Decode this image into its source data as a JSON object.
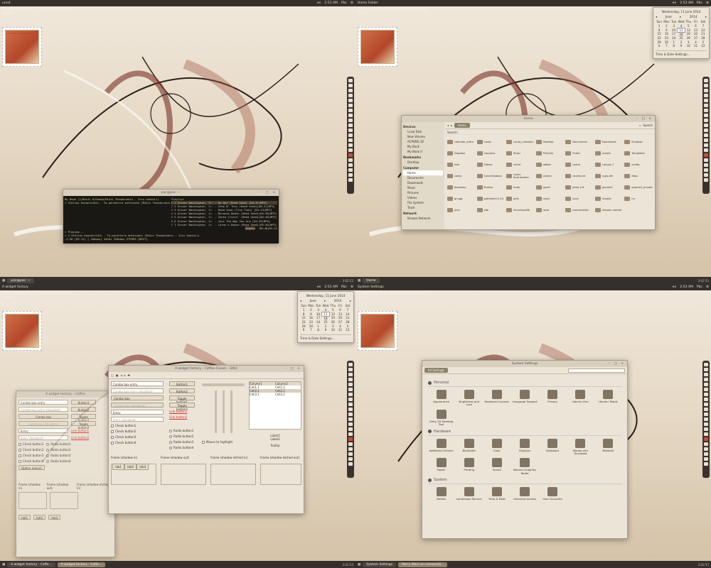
{
  "q1": {
    "topbar": {
      "title": "urxvt",
      "lang": "en",
      "time": "2:53 AM",
      "user": "Pbc"
    },
    "note": [
      "Stelios Kazantzidis - Ta parathira anthisane",
      "mocp *"
    ],
    "stamp_text": "ΕΛΛΗΝΙΚΗ ΔΗΜΟΚΡΑΤΙΑ",
    "terminal": {
      "title": "pac@pac: ~",
      "left_head": "My Book (1/Music H/Goodo/Mikis Theodorakis - Itin anatoli)",
      "right_head": "Playlist",
      "left_line": "2 Stelios Kazantzidis - Ta parathira anthisane (Mikis Theodorakis - Itin Anatoli) [04:03]",
      "playlist": [
        "1 1 Grover Washington, Jr. - Do Dat (Reed Seed) [04:31|MP3]",
        "2 2 Grover Washington, Jr. - Step N' Thru (Reed Seed)[06:31|MP3]",
        "3 3 Grover Washington, Jr. - Reed Seed (Trio Tune) [04:13|MP3]",
        "4 4 Grover Washington, Jr. - Maracas Beach (Reed Seed)[04:58|MP3]",
        "5 5 Grover Washington, Jr. - Santa Cruzin' (Reed Seed)[05:46|MP3]",
        "6 6 Grover Washington, Jr. - Just The Way You Are [04:59|MP3]",
        "7 7 Grover Washington, Jr. - Loran's Dance (Reed Seed)[05:40|MP3]"
      ],
      "status_label": "Repeat",
      "time": "00:48|03:12",
      "playing": "> Playing...",
      "now": "> 2 Stelios Kazantzidis - Ta parathira anthisane (Mikis Theodorakis - Itin Anatoli)",
      "info": "-2:56 [03:12] [ 44kbps] 44kHz 320kbps STEREO [NEXT]"
    },
    "task": "pac@pac: ~",
    "clock": "3:02:53"
  },
  "q2": {
    "topbar": {
      "title": "Home Folder",
      "lang": "en",
      "time": "2:53 AM",
      "user": "Pbc"
    },
    "note": [
      "Stelios Kazantzidis - Ta parathira anthisane",
      "mocp *"
    ],
    "calendar": {
      "header": "Wednesday, 11 June 2014",
      "month": "June",
      "year": "2014",
      "days": [
        "Sun",
        "Mon",
        "Tue",
        "Wed",
        "Thu",
        "Fri",
        "Sat"
      ],
      "weeks": [
        [
          "1",
          "2",
          "3",
          "4",
          "5",
          "6",
          "7"
        ],
        [
          "8",
          "9",
          "10",
          "11",
          "12",
          "13",
          "14"
        ],
        [
          "15",
          "16",
          "17",
          "18",
          "19",
          "20",
          "21"
        ],
        [
          "22",
          "23",
          "24",
          "25",
          "26",
          "27",
          "28"
        ],
        [
          "29",
          "30",
          "1",
          "2",
          "3",
          "4",
          "5"
        ],
        [
          "6",
          "7",
          "8",
          "9",
          "10",
          "11",
          "12"
        ]
      ],
      "today": "11",
      "settings": "Time & Date Settings..."
    },
    "fm": {
      "title": "Home",
      "crumb": "Home",
      "search_label": "Search:",
      "search_btn": "Search",
      "sidebar": [
        {
          "h": "Devices",
          "items": [
            "Local Disk",
            "New Volume",
            "ACPONS 3Z",
            "My Book",
            "My Book II"
          ]
        },
        {
          "h": "Bookmarks",
          "items": [
            "Desktop"
          ]
        },
        {
          "h": "Computer",
          "items": [
            "Home",
            "Documents",
            "Downloads",
            "Music",
            "Pictures",
            "Videos",
            "File System",
            "Trash"
          ]
        },
        {
          "h": "Network",
          "items": [
            "Browse Network"
          ]
        }
      ],
      "files": [
        "calendar_extra",
        "conky",
        "conky_calendar",
        "Desktop",
        "Documents",
        "Downloads",
        "Dropbox",
        "Dropbox",
        "mocpkrp",
        "Music",
        "Pictures",
        "Public",
        "scripts",
        "Templates",
        "test",
        "Videos",
        "xchat",
        "adobe",
        "cache",
        "compiz-1",
        "config",
        "conky",
        "CoverGloobus",
        "cover-thumbnailer",
        "covers",
        "covers.txt",
        "cups.del",
        "dbus",
        "dockbarx",
        "Dustox",
        "fonts",
        "gconf",
        "gimp-2.8",
        "gnome2",
        "gnome2_private",
        "gnugg",
        "gstreamer-0.10",
        "gvfs",
        "icons",
        "local",
        "mozilla",
        "nv",
        "java",
        "kde",
        "launchpadlib",
        "local",
        "macromedia",
        "mission-control"
      ]
    },
    "task": "Home",
    "clock": "3:02:53"
  },
  "q3": {
    "topbar": {
      "title": "A widget factory",
      "lang": "en",
      "time": "2:53 AM",
      "user": "Pbc"
    },
    "note": [
      "Stelios Kazantzidis - Ta parathira anthisane",
      "mocp *"
    ],
    "calendar": {
      "header": "Wednesday, 11 June 2014",
      "month": "June",
      "year": "2014",
      "days": [
        "Sun",
        "Mon",
        "Tue",
        "Wed",
        "Thu",
        "Fri",
        "Sat"
      ],
      "weeks": [
        [
          "1",
          "2",
          "3",
          "4",
          "5",
          "6",
          "7"
        ],
        [
          "8",
          "9",
          "10",
          "11",
          "12",
          "13",
          "14"
        ],
        [
          "15",
          "16",
          "17",
          "18",
          "19",
          "20",
          "21"
        ],
        [
          "22",
          "23",
          "24",
          "25",
          "26",
          "27",
          "28"
        ],
        [
          "29",
          "30",
          "1",
          "2",
          "3",
          "4",
          "5"
        ],
        [
          "6",
          "7",
          "8",
          "9",
          "10",
          "11",
          "12"
        ]
      ],
      "today": "11",
      "settings": "Time & Date Settings..."
    },
    "wf_back": {
      "title": "A widget factory - Coffee",
      "combo": [
        "Combo box entry",
        "Combo box entry (disabled)",
        "Combo box",
        "Combo box (disabled)"
      ],
      "entry": [
        "Entry",
        "Entry (disabled)"
      ],
      "buttons": [
        "Button1",
        "Button2",
        "Toggle button1",
        "Toggle button2"
      ],
      "links": [
        "Link button1",
        "Link button2"
      ],
      "checks": [
        "Check button1",
        "Check button2",
        "Check button3",
        "Check button4"
      ],
      "radios": [
        "Radio button1",
        "Radio button2",
        "Radio button3",
        "Radio button4"
      ],
      "option": "Option menu1",
      "frames": [
        "Frame (shadow in)",
        "Frame (shadow out)",
        "Frame (shadow etched in)"
      ],
      "tabs": [
        "tab1",
        "tab2",
        "tab3"
      ]
    },
    "wf_front": {
      "title": "A widget factory - Coffee-Cream - GtK3",
      "combo": [
        "Combo box entry",
        "Combo box entry (disabled)",
        "Combo box",
        "Combo box (disabled)"
      ],
      "entry": [
        "Entry",
        "Entry (disabled)"
      ],
      "buttons": [
        "Button1",
        "Button2",
        "Toggle button1",
        "Toggle button2"
      ],
      "links": [
        "Link button1",
        "Link button2"
      ],
      "checks": [
        "Check button1",
        "Check button2",
        "Check button3",
        "Check button4"
      ],
      "radios": [
        "Radio button1",
        "Radio button2",
        "Radio button3",
        "Radio button4"
      ],
      "columns": [
        "Column1",
        "Column2"
      ],
      "cells": [
        [
          "Cell1.1",
          "Cell1.2"
        ],
        [
          "Cell2.1",
          "Cell2.2"
        ],
        [
          "Cell3.1",
          "Cell3.2"
        ]
      ],
      "labels": [
        "Label1",
        "Label2"
      ],
      "tooltip": "Tooltip",
      "mouse": "Mouse to highlight",
      "frames": [
        "Frame (shadow in)",
        "Frame (shadow out)",
        "Frame (shadow etched in)",
        "Frame (shadow etched out)"
      ],
      "tabs": [
        "tab1",
        "tab2",
        "tab3"
      ]
    },
    "tasks": [
      "A widget factory - Coffe...",
      "A widget factory - Coffe..."
    ],
    "clock": "3:02:53"
  },
  "q4": {
    "topbar": {
      "title": "System Settings",
      "lang": "en",
      "time": "2:53 AM",
      "user": "Pbc"
    },
    "note": [
      "Stelios Kazantzidis - Ta parathira anthisane",
      "mocp *"
    ],
    "ss": {
      "title": "System Settings",
      "all": "All Settings",
      "sections": [
        {
          "name": "Personal",
          "items": [
            "Appearance",
            "Brightness and Lock",
            "Keyboard Layouts",
            "Language Support",
            "Privacy",
            "Ubuntu One",
            "Ubuntu Tweak",
            "Unity 2D Desktop Tool"
          ]
        },
        {
          "name": "Hardware",
          "items": [
            "Additional Drivers",
            "Bluetooth",
            "Color",
            "Displays",
            "Keyboard",
            "Mouse and Touchpad",
            "Network",
            "Power",
            "Printing",
            "Sound",
            "Wacom Graphics Tablet"
          ]
        },
        {
          "name": "System",
          "items": [
            "Details",
            "Landscape Service",
            "Time & Date",
            "Universal Access",
            "User Accounts"
          ]
        }
      ]
    },
    "tasks": [
      "System Settings",
      "Parcy (Pac) on cersonoSi..."
    ],
    "clock": "3:02:53"
  }
}
